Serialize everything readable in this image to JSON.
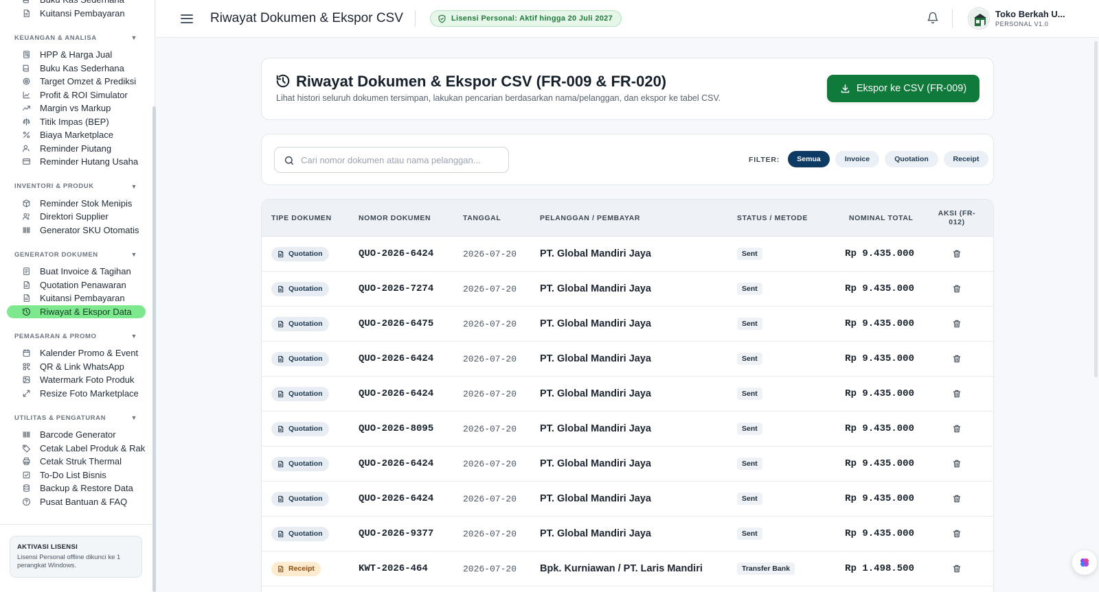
{
  "sidebar": {
    "top_items": [
      {
        "label": "Buku Kas Sederhana",
        "icon": "book-icon"
      },
      {
        "label": "Kuitansi Pembayaran",
        "icon": "receipt-icon"
      }
    ],
    "sections": [
      {
        "title": "KEUANGAN & ANALISA",
        "items": [
          {
            "label": "HPP & Harga Jual",
            "icon": "calculator-icon"
          },
          {
            "label": "Buku Kas Sederhana",
            "icon": "book-icon"
          },
          {
            "label": "Target Omzet & Prediksi",
            "icon": "target-icon"
          },
          {
            "label": "Profit & ROI Simulator",
            "icon": "chart-line-icon"
          },
          {
            "label": "Margin vs Markup",
            "icon": "trend-icon"
          },
          {
            "label": "Titik Impas (BEP)",
            "icon": "scale-icon"
          },
          {
            "label": "Biaya Marketplace",
            "icon": "percent-icon"
          },
          {
            "label": "Reminder Piutang",
            "icon": "user-clock-icon"
          },
          {
            "label": "Reminder Hutang Usaha",
            "icon": "credit-card-icon"
          }
        ]
      },
      {
        "title": "INVENTORI & PRODUK",
        "items": [
          {
            "label": "Reminder Stok Menipis",
            "icon": "box-icon"
          },
          {
            "label": "Direktori Supplier",
            "icon": "users-icon"
          },
          {
            "label": "Generator SKU Otomatis",
            "icon": "barcode-icon"
          }
        ]
      },
      {
        "title": "GENERATOR DOKUMEN",
        "items": [
          {
            "label": "Buat Invoice & Tagihan",
            "icon": "invoice-icon"
          },
          {
            "label": "Quotation Penawaran",
            "icon": "file-text-icon"
          },
          {
            "label": "Kuitansi Pembayaran",
            "icon": "receipt-icon"
          },
          {
            "label": "Riwayat & Ekspor Data",
            "icon": "history-icon",
            "active": true
          }
        ]
      },
      {
        "title": "PEMASARAN & PROMO",
        "items": [
          {
            "label": "Kalender Promo & Event",
            "icon": "calendar-icon"
          },
          {
            "label": "QR & Link WhatsApp",
            "icon": "qr-icon"
          },
          {
            "label": "Watermark Foto Produk",
            "icon": "image-icon"
          },
          {
            "label": "Resize Foto Marketplace",
            "icon": "resize-icon"
          }
        ]
      },
      {
        "title": "UTILITAS & PENGATURAN",
        "items": [
          {
            "label": "Barcode Generator",
            "icon": "barcode-icon"
          },
          {
            "label": "Cetak Label Produk & Rak",
            "icon": "tag-icon"
          },
          {
            "label": "Cetak Struk Thermal",
            "icon": "printer-icon"
          },
          {
            "label": "To-Do List Bisnis",
            "icon": "checkbox-icon"
          },
          {
            "label": "Backup & Restore Data",
            "icon": "database-icon"
          },
          {
            "label": "Pusat Bantuan & FAQ",
            "icon": "help-icon"
          }
        ]
      }
    ],
    "license": {
      "title": "AKTIVASI LISENSI",
      "desc": "Lisensi Personal offline dikunci ke 1 perangkat Windows."
    }
  },
  "header": {
    "title": "Riwayat Dokumen & Ekspor CSV",
    "license_pill": "Lisensi Personal: Aktif hingga 20 Juli 2027",
    "user_name": "Toko Berkah U...",
    "user_sub": "PERSONAL V1.0"
  },
  "page": {
    "title": "Riwayat Dokumen & Ekspor CSV (FR-009 & FR-020)",
    "subtitle": "Lihat histori seluruh dokumen tersimpan, lakukan pencarian berdasarkan nama/pelanggan, dan ekspor ke tabel CSV.",
    "export_label": "Ekspor ke CSV (FR-009)"
  },
  "filter": {
    "search_placeholder": "Cari nomor dokumen atau nama pelanggan...",
    "search_value": "",
    "label": "FILTER:",
    "chips": [
      "Semua",
      "Invoice",
      "Quotation",
      "Receipt"
    ],
    "active_chip": "Semua"
  },
  "table": {
    "columns": [
      "TIPE DOKUMEN",
      "NOMOR DOKUMEN",
      "TANGGAL",
      "PELANGGAN / PEMBAYAR",
      "STATUS / METODE",
      "NOMINAL TOTAL",
      "AKSI (FR-012)"
    ],
    "rows": [
      {
        "type": "Quotation",
        "no": "QUO-2026-6424",
        "date": "2026-07-20",
        "customer": "PT. Global Mandiri Jaya",
        "status": "Sent",
        "amount": "Rp 9.435.000"
      },
      {
        "type": "Quotation",
        "no": "QUO-2026-7274",
        "date": "2026-07-20",
        "customer": "PT. Global Mandiri Jaya",
        "status": "Sent",
        "amount": "Rp 9.435.000"
      },
      {
        "type": "Quotation",
        "no": "QUO-2026-6475",
        "date": "2026-07-20",
        "customer": "PT. Global Mandiri Jaya",
        "status": "Sent",
        "amount": "Rp 9.435.000"
      },
      {
        "type": "Quotation",
        "no": "QUO-2026-6424",
        "date": "2026-07-20",
        "customer": "PT. Global Mandiri Jaya",
        "status": "Sent",
        "amount": "Rp 9.435.000"
      },
      {
        "type": "Quotation",
        "no": "QUO-2026-6424",
        "date": "2026-07-20",
        "customer": "PT. Global Mandiri Jaya",
        "status": "Sent",
        "amount": "Rp 9.435.000"
      },
      {
        "type": "Quotation",
        "no": "QUO-2026-8095",
        "date": "2026-07-20",
        "customer": "PT. Global Mandiri Jaya",
        "status": "Sent",
        "amount": "Rp 9.435.000"
      },
      {
        "type": "Quotation",
        "no": "QUO-2026-6424",
        "date": "2026-07-20",
        "customer": "PT. Global Mandiri Jaya",
        "status": "Sent",
        "amount": "Rp 9.435.000"
      },
      {
        "type": "Quotation",
        "no": "QUO-2026-6424",
        "date": "2026-07-20",
        "customer": "PT. Global Mandiri Jaya",
        "status": "Sent",
        "amount": "Rp 9.435.000"
      },
      {
        "type": "Quotation",
        "no": "QUO-2026-9377",
        "date": "2026-07-20",
        "customer": "PT. Global Mandiri Jaya",
        "status": "Sent",
        "amount": "Rp 9.435.000"
      },
      {
        "type": "Receipt",
        "no": "KWT-2026-464",
        "date": "2026-07-20",
        "customer": "Bpk. Kurniawan / PT. Laris Mandiri",
        "status": "Transfer Bank",
        "amount": "Rp 1.498.500"
      }
    ]
  },
  "colors": {
    "accent_green": "#0f7a3a",
    "active_nav": "#7ee88f",
    "chip_active": "#0c3a63"
  }
}
